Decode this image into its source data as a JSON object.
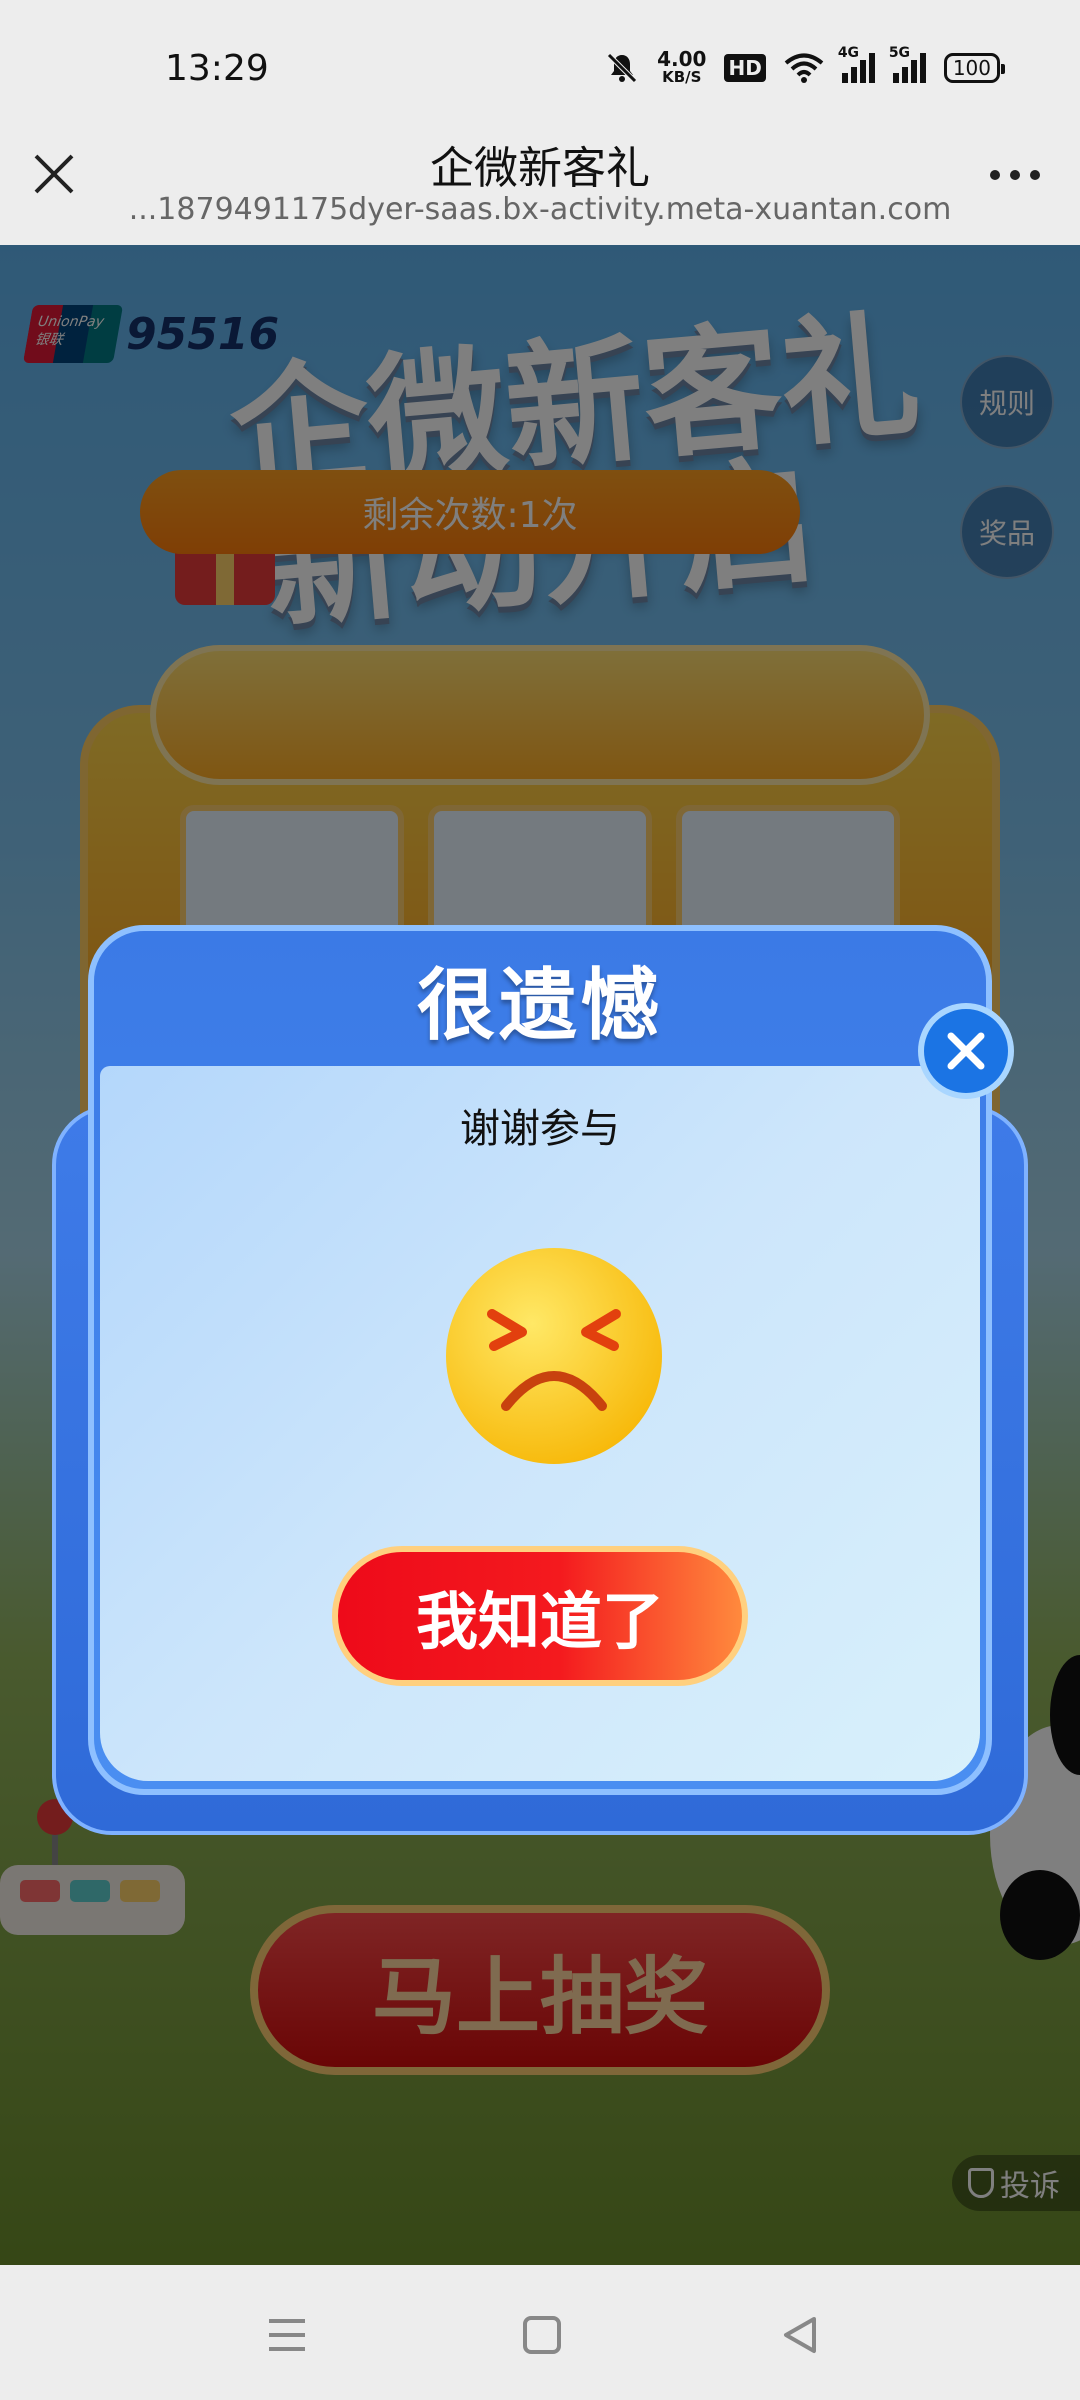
{
  "status_bar": {
    "time": "13:29",
    "net_speed_value": "4.00",
    "net_speed_unit": "KB/S",
    "hd_label": "HD",
    "signal_1_label": "4G",
    "signal_2_label": "5G",
    "battery": "100"
  },
  "nav": {
    "title": "企微新客礼",
    "url": "...1879491175dyer-saas.bx-activity.meta-xuantan.com",
    "close_icon": "close-icon",
    "more_icon": "more-icon"
  },
  "page": {
    "brand_logo_text": "UnionPay 银联",
    "brand_number": "95516",
    "hero_line_1": "企微新客礼",
    "hero_line_2": "新动开启",
    "rules_button": "规则",
    "prizes_button": "奖品",
    "remaining_count": "剩余次数:1次",
    "draw_button": "马上抽奖",
    "report_button": "投诉"
  },
  "modal": {
    "title": "很遗憾",
    "message": "谢谢参与",
    "face_icon": "sad-face-icon",
    "confirm_button": "我知道了",
    "close_icon": "close-icon"
  },
  "colors": {
    "modal_blue": "#3b7ae6",
    "button_red": "#ee0a1a",
    "close_blue": "#1b74e4"
  },
  "system_nav": {
    "menu_icon": "menu-icon",
    "home_icon": "home-square-icon",
    "back_icon": "back-triangle-icon"
  }
}
